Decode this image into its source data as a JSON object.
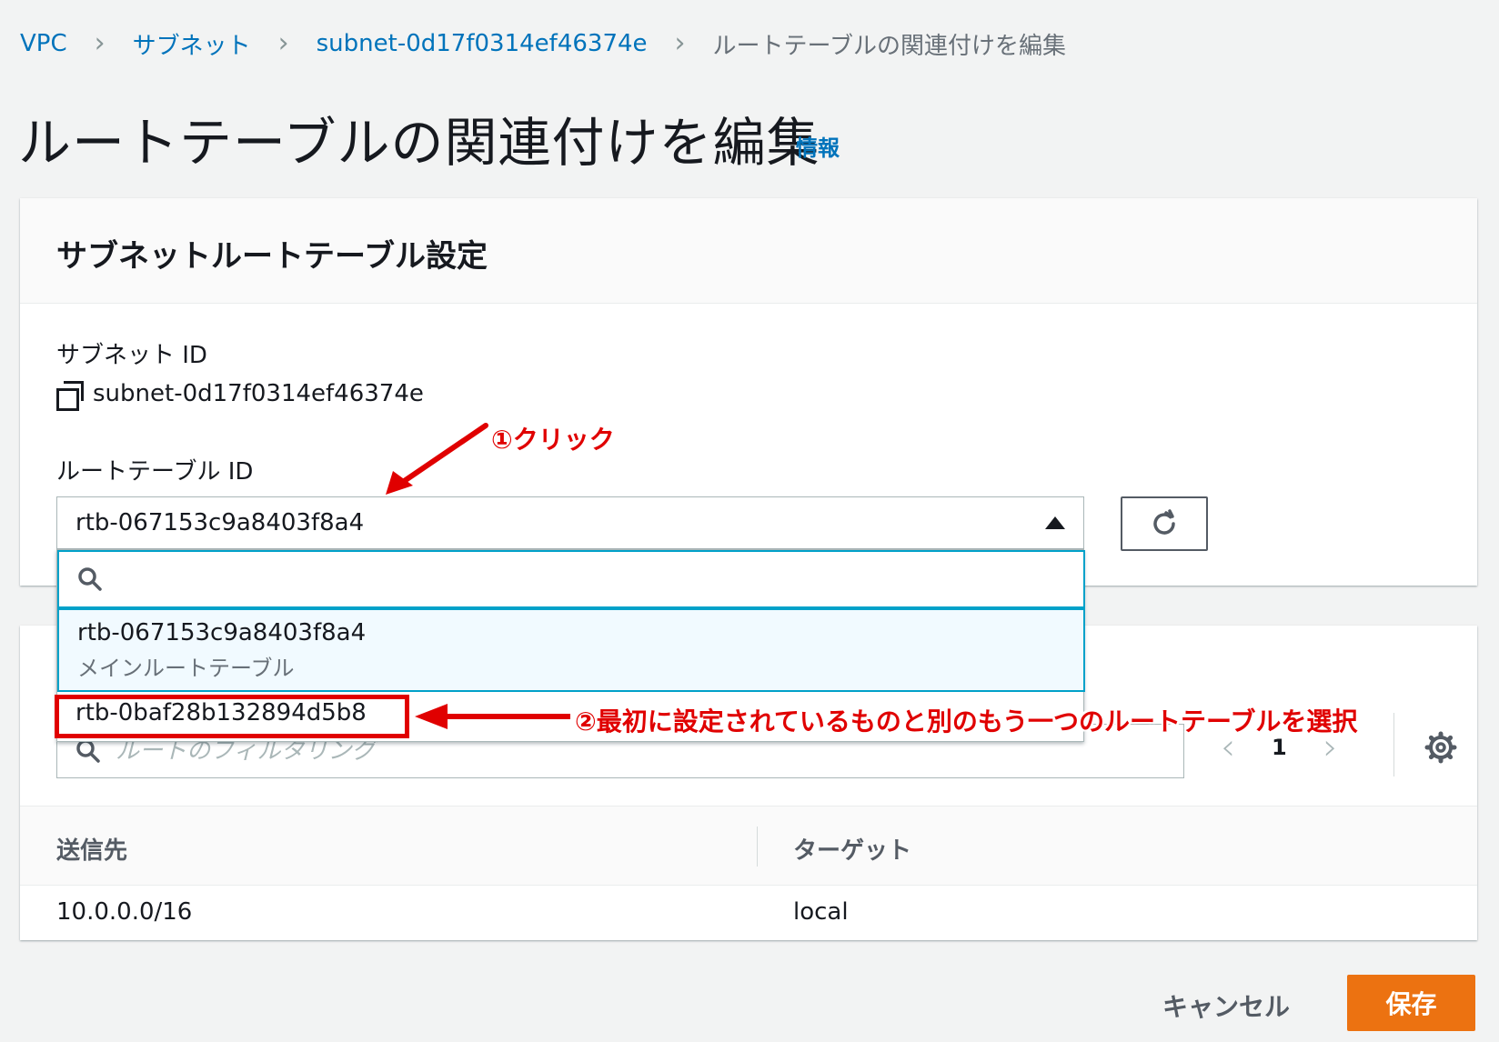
{
  "breadcrumb": {
    "items": [
      "VPC",
      "サブネット",
      "subnet-0d17f0314ef46374e"
    ],
    "current": "ルートテーブルの関連付けを編集"
  },
  "page": {
    "title": "ルートテーブルの関連付けを編集",
    "info_link": "情報"
  },
  "settings_panel": {
    "heading": "サブネットルートテーブル設定",
    "subnet_id_label": "サブネット ID",
    "subnet_id_value": "subnet-0d17f0314ef46374e",
    "route_table_label": "ルートテーブル ID",
    "selected_route_table": "rtb-067153c9a8403f8a4"
  },
  "dropdown": {
    "search_placeholder": "",
    "options": [
      {
        "id": "rtb-067153c9a8403f8a4",
        "description": "メインルートテーブル"
      },
      {
        "id": "rtb-0baf28b132894d5b8",
        "description": ""
      }
    ]
  },
  "routes_panel": {
    "filter_placeholder": "ルートのフィルタリング",
    "page_number": "1",
    "columns": [
      "送信先",
      "ターゲット"
    ],
    "rows": [
      {
        "destination": "10.0.0.0/16",
        "target": "local"
      }
    ]
  },
  "annotations": {
    "step1": "①クリック",
    "step2": "②最初に設定されているものと別のもう一つのルートテーブルを選択"
  },
  "actions": {
    "cancel": "キャンセル",
    "save": "保存"
  },
  "colors": {
    "link": "#0073bb",
    "primary_button": "#ec7211",
    "focus": "#00a1c9",
    "annotation": "#e00000"
  }
}
